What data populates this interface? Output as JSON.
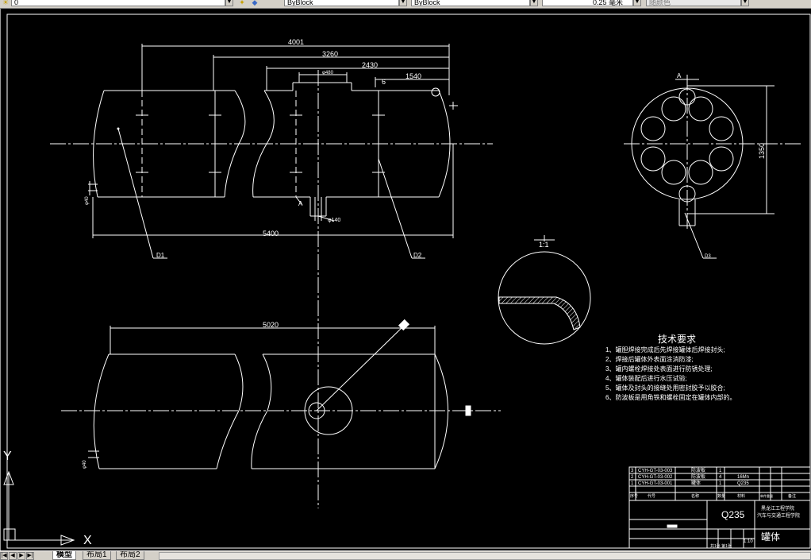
{
  "toolbar": {
    "layer_value": "0",
    "color_value": "ByBlock",
    "linetype_value": "ByBlock",
    "lineweight_value": "0.25 毫米",
    "plotstyle_value": "随颜色"
  },
  "dimensions": {
    "top_4001": "4001",
    "top_3260": "3260",
    "top_2430": "2430",
    "top_1540": "1540",
    "top_phi480": "φ480",
    "top_6": "6",
    "top_phi140": "φ140",
    "top_5400": "5400",
    "left_phi40": "φ40",
    "top_A": "A",
    "bottom_5020": "5020",
    "bottom_phi": "φ40",
    "side_1350": "1350",
    "side_A": "A"
  },
  "callouts": {
    "d1": "D1",
    "d2": "D2",
    "d3": "D3",
    "detail_scale": "1:1"
  },
  "tech": {
    "title": "技术要求",
    "lines": [
      "1、罐胆焊接完成后先焊接罐体后焊接封头;",
      "2、焊接后罐体外表面涂消防漆;",
      "3、罐内螺栓焊接处表面进行防锈处理;",
      "4、罐体装配后进行水压试验;",
      "5、罐体及封头的接缝处用密封胶予以胶合;",
      "6、防波板是用角铁和螺栓固定在罐体内部的。"
    ]
  },
  "title_block": {
    "rows": [
      {
        "no": "3",
        "code": "CYH-GT-03-003",
        "name": "防波板",
        "qty": "1",
        "mat": ""
      },
      {
        "no": "2",
        "code": "CYH-GT-03-002",
        "name": "防波板",
        "qty": "4",
        "mat": "16Mn"
      },
      {
        "no": "1",
        "code": "CYH-GT-03-001",
        "name": "罐体",
        "qty": "1",
        "mat": "Q235"
      }
    ],
    "header_no": "序号",
    "header_code": "代号",
    "header_name": "名称",
    "header_qty": "数量",
    "header_mat": "材料",
    "header_weight": "单件重量",
    "header_note": "备注",
    "material": "Q235",
    "school_line1": "黑龙江工程学院",
    "school_line2": "汽车与交通工程学院",
    "part_name": "罐体",
    "scale": "1:10",
    "sheet": "共1张 第1张"
  },
  "ucs": {
    "x_label": "X",
    "y_label": "Y"
  },
  "tabs": [
    {
      "label": "模型"
    },
    {
      "label": "布局1"
    },
    {
      "label": "布局2"
    }
  ]
}
